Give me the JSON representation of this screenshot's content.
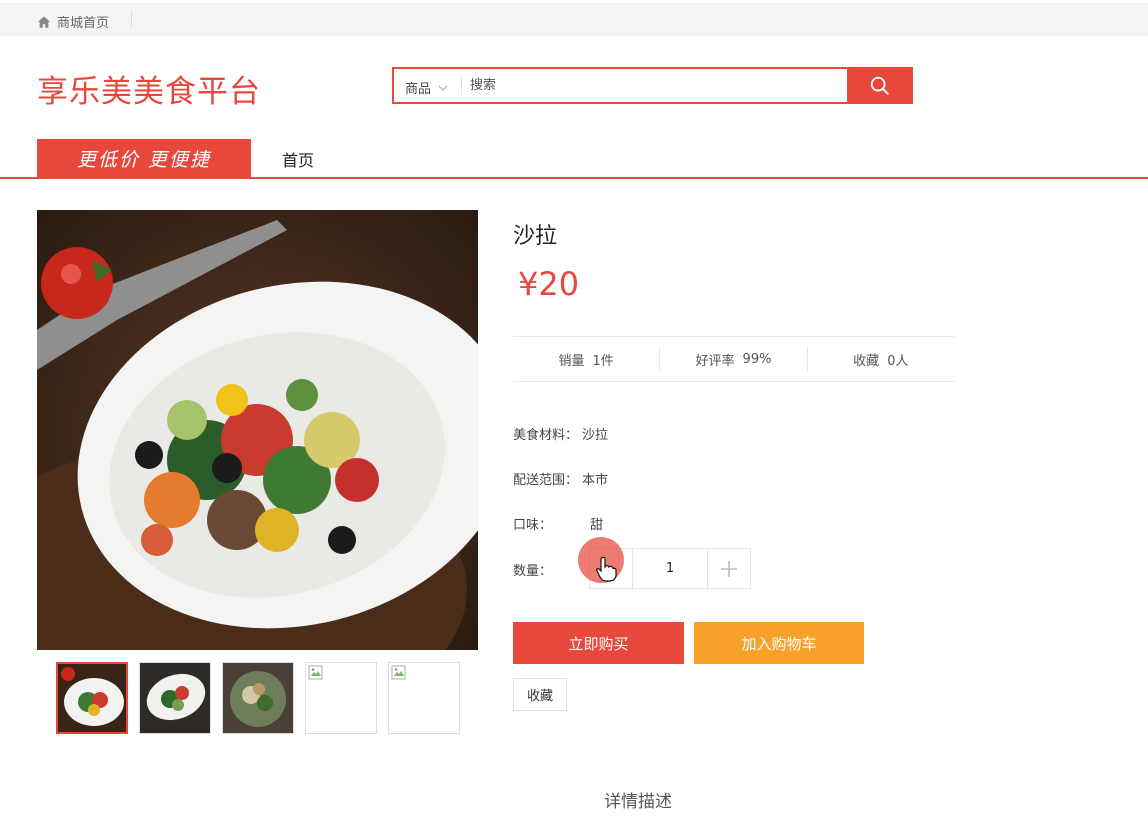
{
  "topbar": {
    "home_link": "商城首页"
  },
  "header": {
    "logo": "享乐美美食平台",
    "search": {
      "category": "商品",
      "placeholder": "搜索"
    }
  },
  "nav": {
    "slogan": "更低价 更便捷",
    "home": "首页"
  },
  "product": {
    "title": "沙拉",
    "price": "¥20",
    "stats": [
      {
        "label": "销量",
        "value": "1件"
      },
      {
        "label": "好评率",
        "value": "99%"
      },
      {
        "label": "收藏",
        "value": "0人"
      }
    ],
    "attributes": [
      {
        "label": "美食材料：",
        "value": "沙拉"
      },
      {
        "label": "配送范围：",
        "value": "本市"
      },
      {
        "label": "口味：",
        "value": "甜"
      }
    ],
    "quantity_label": "数量：",
    "quantity": "1",
    "buy_now": "立即购买",
    "add_cart": "加入购物车",
    "favorite": "收藏"
  },
  "detail_heading": "详情描述",
  "colors": {
    "accent": "#e8483c",
    "cart": "#f7a12b"
  }
}
